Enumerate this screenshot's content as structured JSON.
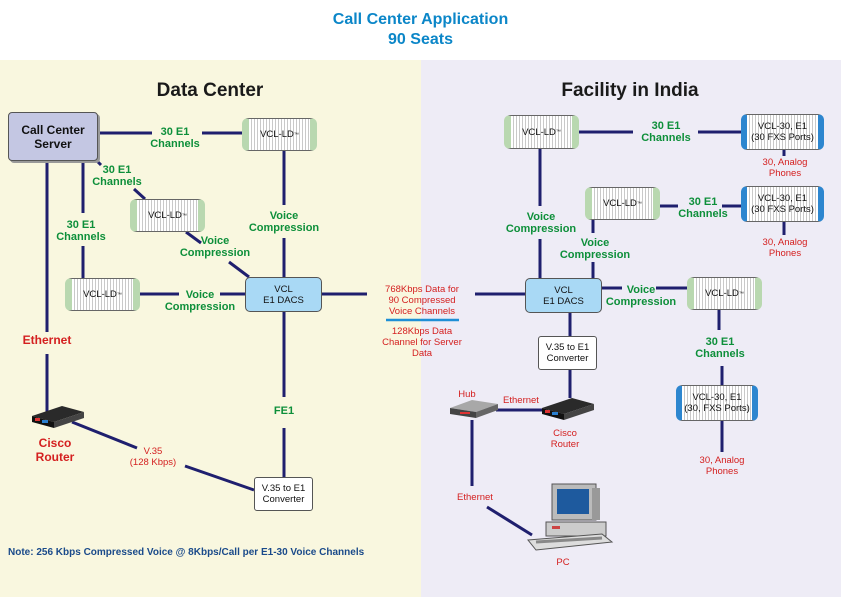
{
  "title": {
    "line1": "Call Center Application",
    "line2": "90 Seats"
  },
  "sections": {
    "left": "Data Center",
    "right": "Facility in India"
  },
  "colors": {
    "title": "#0b86c8",
    "link_label": "#0d8f3a",
    "annotation": "#d42020",
    "wire": "#1f1f6e",
    "left_bg": "#f9f7df",
    "right_bg": "#eeecf6",
    "note": "#1a4a8a"
  },
  "data_center": {
    "server": {
      "line1": "Call Center",
      "line2": "Server"
    },
    "ld_top": {
      "label": "VCL-LD",
      "mark": "™"
    },
    "ld_mid": {
      "label": "VCL-LD",
      "mark": "™"
    },
    "ld_left": {
      "label": "VCL-LD",
      "mark": "™"
    },
    "dacs": {
      "line1": "VCL",
      "line2": "E1 DACS"
    },
    "converter": {
      "line1": "V.35 to E1",
      "line2": "Converter"
    },
    "router": {
      "line1": "Cisco",
      "line2": "Router",
      "icon": "router-icon"
    },
    "labels": {
      "e1_top": {
        "line1": "30 E1",
        "line2": "Channels"
      },
      "e1_diag": {
        "line1": "30 E1",
        "line2": "Channels"
      },
      "e1_left": {
        "line1": "30 E1",
        "line2": "Channels"
      },
      "vc_vertical": {
        "line1": "Voice",
        "line2": "Compression"
      },
      "vc_diag": {
        "line1": "Voice",
        "line2": "Compression"
      },
      "vc_horizontal": {
        "line1": "Voice",
        "line2": "Compression"
      },
      "ethernet": "Ethernet",
      "fe1": "FE1",
      "v35": {
        "line1": "V.35",
        "line2": "(128 Kbps)"
      }
    },
    "note": "Note: 256 Kbps Compressed Voice @ 8Kbps/Call per E1-30 Voice Channels"
  },
  "link": {
    "voice_data": {
      "line1": "768Kbps Data for",
      "line2": "90 Compressed",
      "line3": "Voice Channels"
    },
    "server_data": {
      "line1": "128Kbps Data",
      "line2": "Channel for Server",
      "line3": "Data"
    }
  },
  "india": {
    "ld_top": {
      "label": "VCL-LD",
      "mark": "™"
    },
    "ld_mid": {
      "label": "VCL-LD",
      "mark": "™"
    },
    "ld_right": {
      "label": "VCL-LD",
      "mark": "™"
    },
    "v30_top": {
      "line1": "VCL-30, E1",
      "line2": "(30 FXS Ports)"
    },
    "v30_mid": {
      "line1": "VCL-30, E1",
      "line2": "(30 FXS Ports)"
    },
    "v30_bottom": {
      "line1": "VCL-30, E1",
      "line2": "(30, FXS Ports)"
    },
    "dacs": {
      "line1": "VCL",
      "line2": "E1 DACS"
    },
    "converter": {
      "line1": "V.35 to E1",
      "line2": "Converter"
    },
    "router": {
      "line1": "Cisco",
      "line2": "Router",
      "icon": "router-icon"
    },
    "hub": {
      "label": "Hub",
      "icon": "hub-icon"
    },
    "pc": {
      "label": "PC",
      "icon": "pc-icon"
    },
    "labels": {
      "e1_top": {
        "line1": "30 E1",
        "line2": "Channels"
      },
      "e1_mid": {
        "line1": "30 E1",
        "line2": "Channels"
      },
      "e1_right": {
        "line1": "30 E1",
        "line2": "Channels"
      },
      "vc_left": {
        "line1": "Voice",
        "line2": "Compression"
      },
      "vc_mid": {
        "line1": "Voice",
        "line2": "Compression"
      },
      "vc_right": {
        "line1": "Voice",
        "line2": "Compression"
      },
      "phones_top": {
        "line1": "30, Analog",
        "line2": "Phones"
      },
      "phones_mid": {
        "line1": "30, Analog",
        "line2": "Phones"
      },
      "phones_bottom": {
        "line1": "30, Analog",
        "line2": "Phones"
      },
      "ethernet_h": "Ethernet",
      "ethernet_v": "Ethernet"
    }
  }
}
